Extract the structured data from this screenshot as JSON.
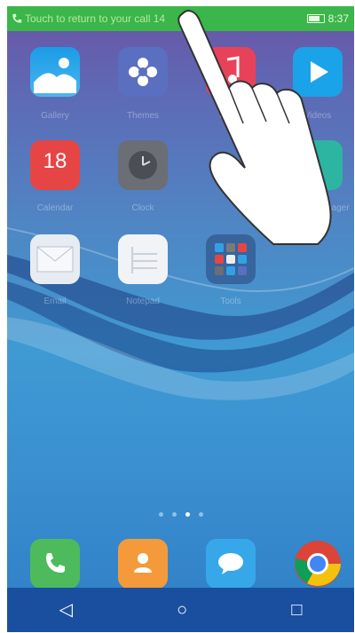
{
  "status_bar": {
    "message": "Touch to return to your call 14",
    "time": "8:37"
  },
  "apps": [
    {
      "label": "Gallery"
    },
    {
      "label": "Themes"
    },
    {
      "label": "Music"
    },
    {
      "label": "Videos"
    },
    {
      "label": "Calendar",
      "badge": "18"
    },
    {
      "label": "Clock"
    },
    {
      "label": "Phone Manager"
    },
    {
      "label": "Email"
    },
    {
      "label": "Notepad"
    },
    {
      "label": "Tools"
    }
  ],
  "dock": [
    {
      "label": "Phone"
    },
    {
      "label": "Contacts"
    },
    {
      "label": "Messages"
    },
    {
      "label": "Chrome"
    }
  ],
  "page_indicator": {
    "count": 4,
    "active": 3
  }
}
